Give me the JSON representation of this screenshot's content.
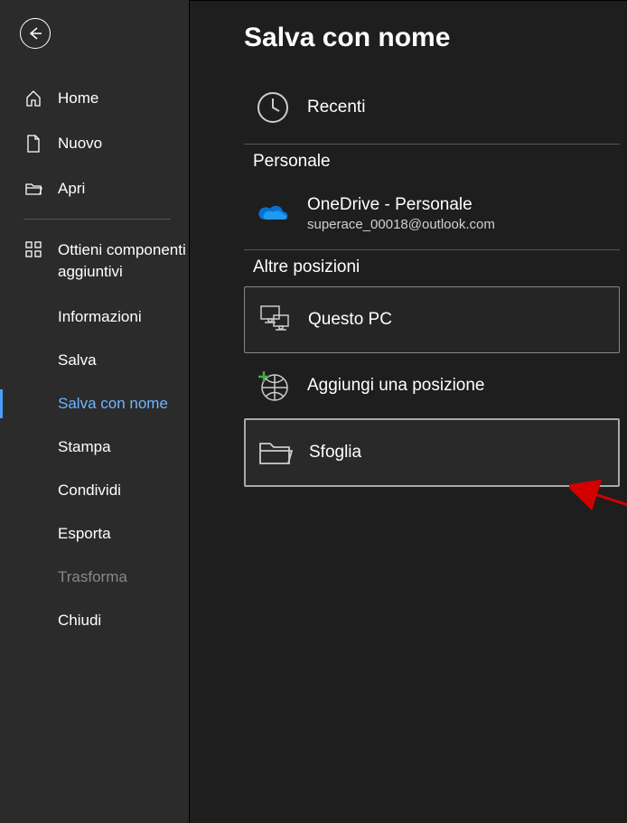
{
  "sidebar": {
    "home": "Home",
    "new": "Nuovo",
    "open": "Apri",
    "addins": "Ottieni componenti aggiuntivi",
    "info": "Informazioni",
    "save": "Salva",
    "save_as": "Salva con nome",
    "print": "Stampa",
    "share": "Condividi",
    "export": "Esporta",
    "transform": "Trasforma",
    "close": "Chiudi"
  },
  "main": {
    "title": "Salva con nome",
    "recent": "Recenti",
    "personal_header": "Personale",
    "onedrive_label": "OneDrive - Personale",
    "onedrive_sub": "superace_00018@outlook.com",
    "other_header": "Altre posizioni",
    "this_pc": "Questo PC",
    "add_place": "Aggiungi una posizione",
    "browse": "Sfoglia"
  }
}
